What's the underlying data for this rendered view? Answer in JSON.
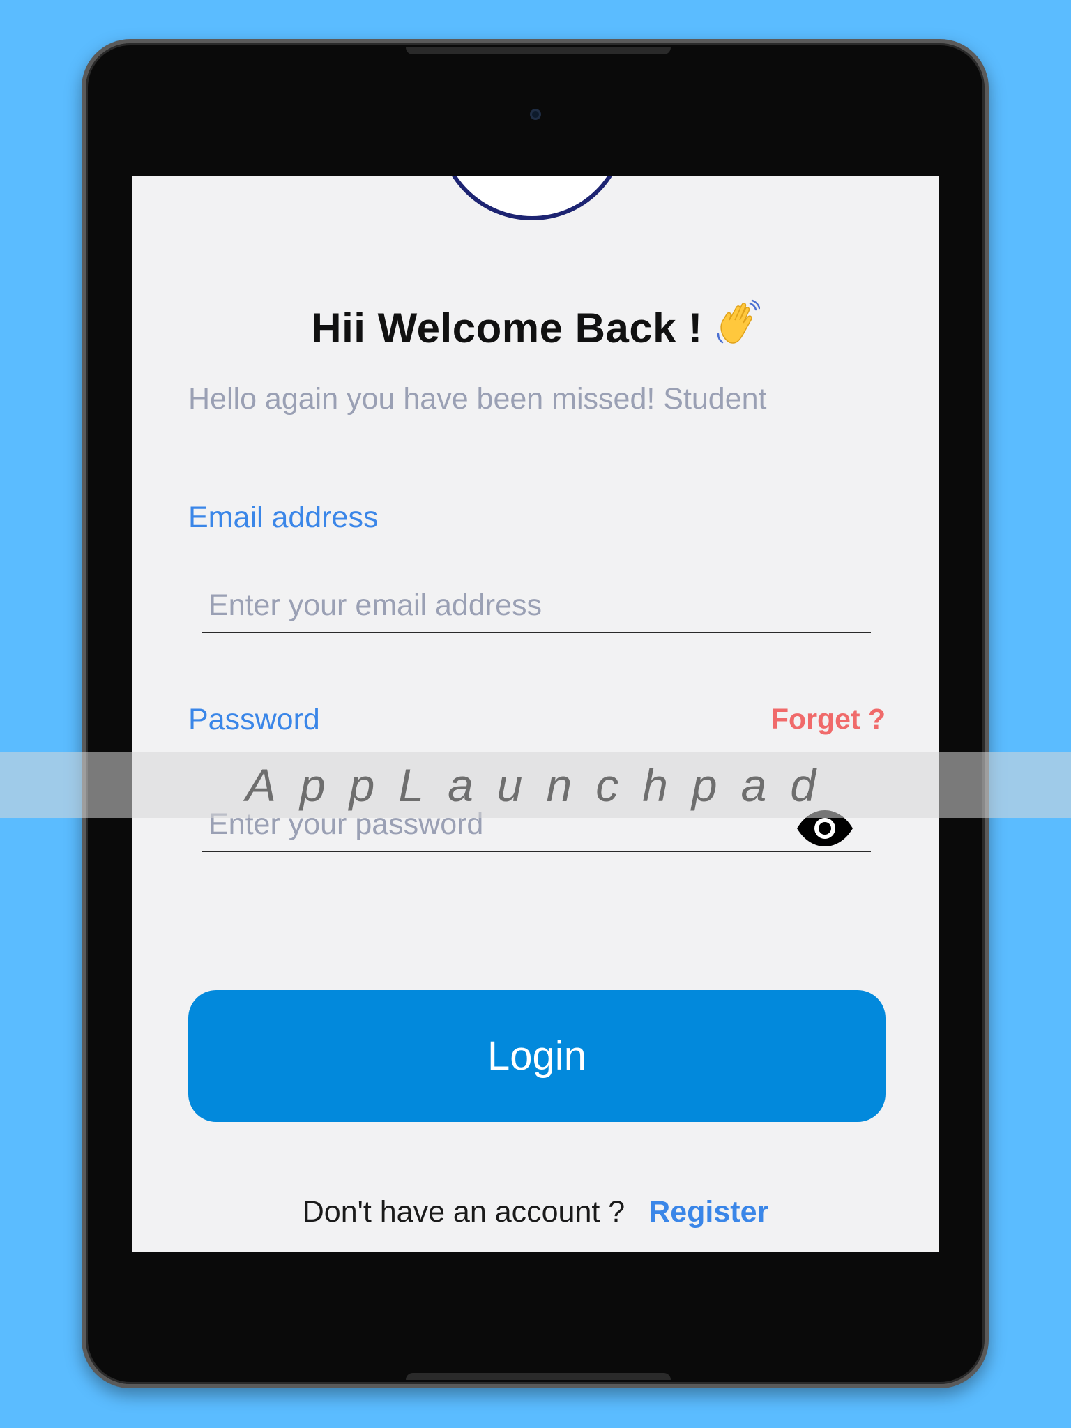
{
  "screen": {
    "title": "Hii Welcome Back !",
    "title_emoji": "waving-hand-icon",
    "subtitle": "Hello again you have been missed! Student"
  },
  "email": {
    "label": "Email address",
    "placeholder": "Enter your email address",
    "value": ""
  },
  "password": {
    "label": "Password",
    "forgot_label": "Forget ?",
    "placeholder": "Enter your password",
    "value": "",
    "visibility_icon": "eye-icon"
  },
  "login_button": {
    "label": "Login"
  },
  "footer": {
    "prompt": "Don't have an account ?",
    "register_label": "Register"
  },
  "watermark": {
    "text": "AppLaunchpad"
  },
  "colors": {
    "background": "#5bbcff",
    "screen": "#f2f2f3",
    "accent_blue": "#3a86e8",
    "button_blue": "#0289dc",
    "forgot_red": "#f06a6a",
    "muted_text": "#9aa0b4",
    "logo_ring": "#1d2472"
  }
}
